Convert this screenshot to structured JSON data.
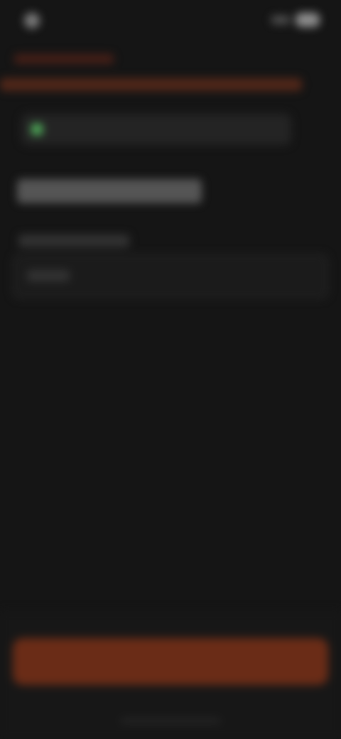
{
  "status_bar": {
    "left_icon": "app-dot-icon",
    "right_icons": [
      "signal-icon",
      "battery-icon"
    ]
  },
  "banner": {
    "icon": "alert-bar-icon"
  },
  "info_row": {
    "icon": "check-icon"
  },
  "form": {
    "input_icon": "none"
  },
  "colors": {
    "background": "#151515",
    "accent": "#6a2c17",
    "success": "#4fae5a"
  }
}
